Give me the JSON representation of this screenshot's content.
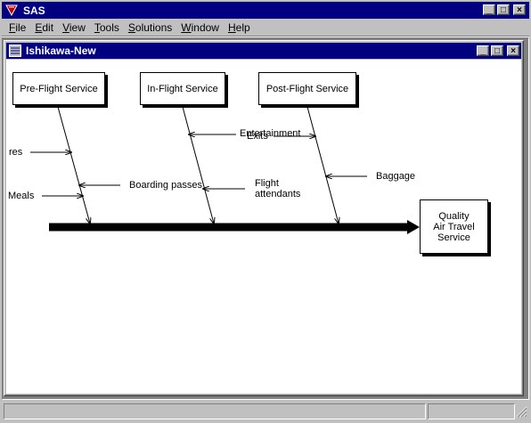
{
  "app": {
    "title": "SAS"
  },
  "menu": [
    {
      "pre": "",
      "u": "F",
      "post": "ile"
    },
    {
      "pre": "",
      "u": "E",
      "post": "dit"
    },
    {
      "pre": "",
      "u": "V",
      "post": "iew"
    },
    {
      "pre": "",
      "u": "T",
      "post": "ools"
    },
    {
      "pre": "",
      "u": "S",
      "post": "olutions"
    },
    {
      "pre": "",
      "u": "W",
      "post": "indow"
    },
    {
      "pre": "",
      "u": "H",
      "post": "elp"
    }
  ],
  "child": {
    "title": "Ishikawa-New"
  },
  "diagram": {
    "categories": [
      "Pre-Flight Service",
      "In-Flight Service",
      "Post-Flight Service"
    ],
    "effect": [
      "Quality",
      "Air Travel",
      "Service"
    ],
    "causes": {
      "pre_1": "res",
      "pre_2": "Meals",
      "pre_3": "Boarding passes",
      "in_1": "Entertainment",
      "in_2": "Exits",
      "in_3": "Flight",
      "in_4": "attendants",
      "post_1": "Baggage"
    }
  }
}
